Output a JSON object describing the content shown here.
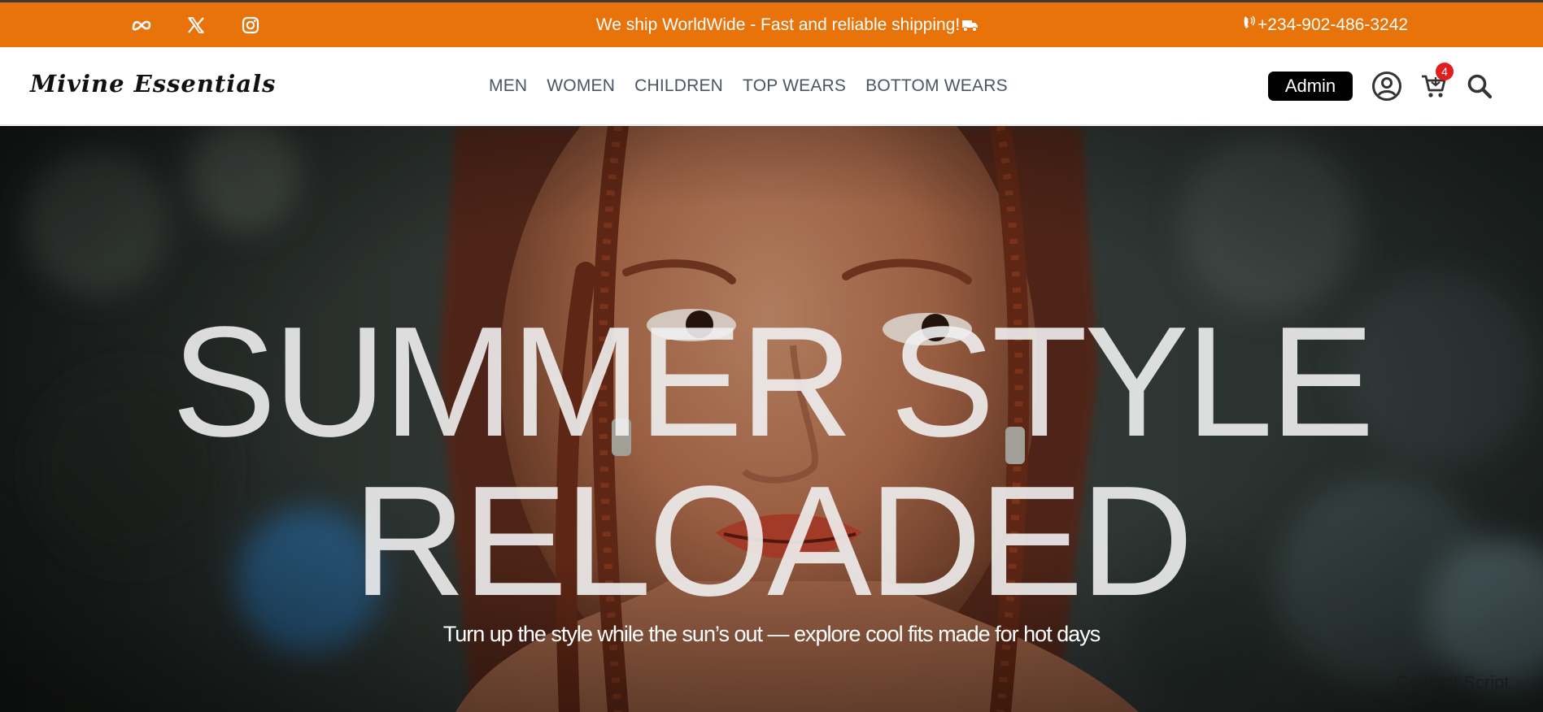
{
  "topbar": {
    "background": "#e8730a",
    "socials": [
      "meta-icon",
      "x-icon",
      "instagram-icon"
    ],
    "announcement": "We ship WorldWide - Fast and reliable shipping!",
    "phone": "+234-902-486-3242"
  },
  "header": {
    "logo": "Mivine Essentials",
    "nav": [
      "MEN",
      "WOMEN",
      "CHILDREN",
      "TOP WEARS",
      "BOTTOM WEARS"
    ],
    "admin_label": "Admin",
    "cart_count": "4",
    "icons": [
      "user-icon",
      "cart-icon",
      "search-icon"
    ]
  },
  "hero": {
    "title_line1": "SUMMER STYLE",
    "title_line2": "RELOADED",
    "subtitle": "Turn up the style while the sun’s out — explore cool fits made for hot days",
    "overlay_label": "Content Script"
  }
}
